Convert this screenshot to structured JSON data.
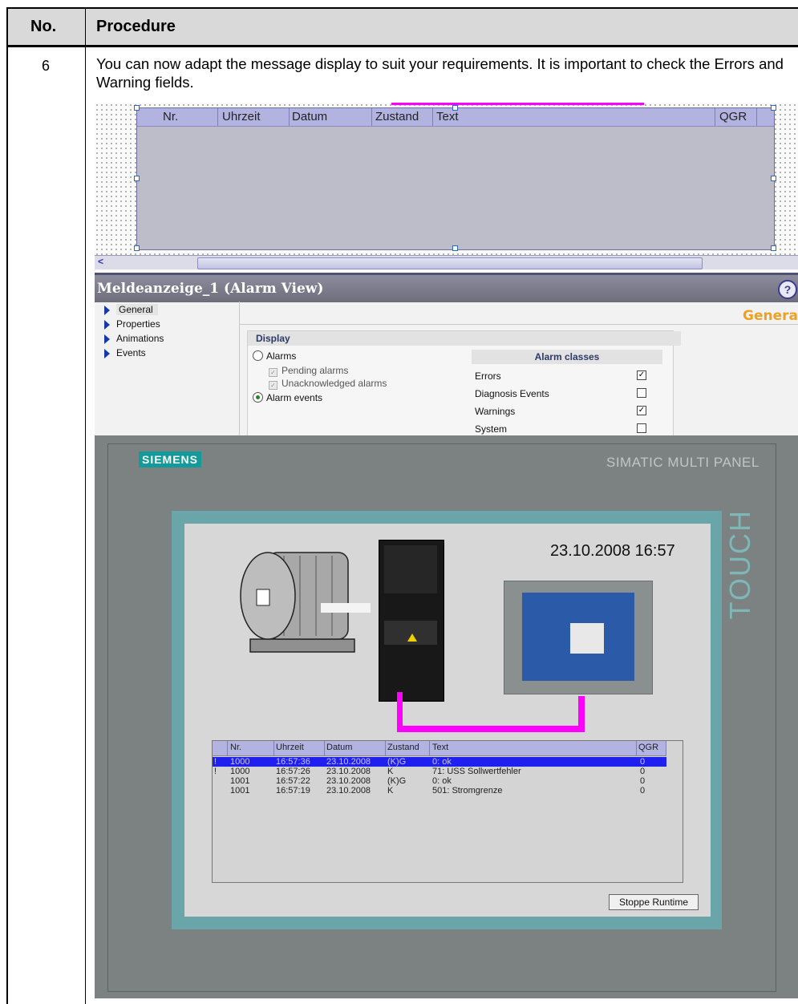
{
  "doc": {
    "col_no": "No.",
    "col_procedure": "Procedure",
    "row_no": "6",
    "row_text": "You can now adapt the message display to suit your requirements. It is important to check the Errors and Warning fields."
  },
  "editor": {
    "columns": [
      "Nr.",
      "Uhrzeit",
      "Datum",
      "Zustand",
      "Text",
      "QGR"
    ]
  },
  "properties": {
    "title": "Meldeanzeige_1 (Alarm View)",
    "nav": [
      "General",
      "Properties",
      "Animations",
      "Events"
    ],
    "section_title": "General",
    "display_label": "Display",
    "opt_alarms": "Alarms",
    "opt_pending": "Pending alarms",
    "opt_unack": "Unacknowledged alarms",
    "opt_events": "Alarm events",
    "classes_label": "Alarm classes",
    "classes": [
      {
        "name": "Errors",
        "checked": true
      },
      {
        "name": "Diagnosis Events",
        "checked": false
      },
      {
        "name": "Warnings",
        "checked": true
      },
      {
        "name": "System",
        "checked": false
      }
    ]
  },
  "panel": {
    "brand": "SIEMENS",
    "model": "SIMATIC MULTI PANEL",
    "touch": "TOUCH",
    "datetime": "23.10.2008 16:57",
    "alarm_columns": [
      "Nr.",
      "Uhrzeit",
      "Datum",
      "Zustand",
      "Text",
      "QGR"
    ],
    "alarm_rows": [
      {
        "flag": "!",
        "nr": "1000",
        "time": "16:57:36",
        "date": "23.10.2008",
        "state": "(K)G",
        "text": "0: ok",
        "qgr": "0"
      },
      {
        "flag": "!",
        "nr": "1000",
        "time": "16:57:26",
        "date": "23.10.2008",
        "state": "K",
        "text": "71: USS Sollwertfehler",
        "qgr": "0"
      },
      {
        "flag": "",
        "nr": "1001",
        "time": "16:57:22",
        "date": "23.10.2008",
        "state": "(K)G",
        "text": "0: ok",
        "qgr": "0"
      },
      {
        "flag": "",
        "nr": "1001",
        "time": "16:57:19",
        "date": "23.10.2008",
        "state": "K",
        "text": "501: Stromgrenze",
        "qgr": "0"
      }
    ],
    "stop_button": "Stoppe Runtime"
  },
  "colors": {
    "header_bg": "#d9d9d9",
    "alarm_header": "#b3b3e2",
    "selection": "#1f1ff0",
    "magenta": "#ff00ff",
    "teal_bezel": "#6aa5a9",
    "siemens_teal": "#139a9a",
    "general_orange": "#f0a020"
  }
}
